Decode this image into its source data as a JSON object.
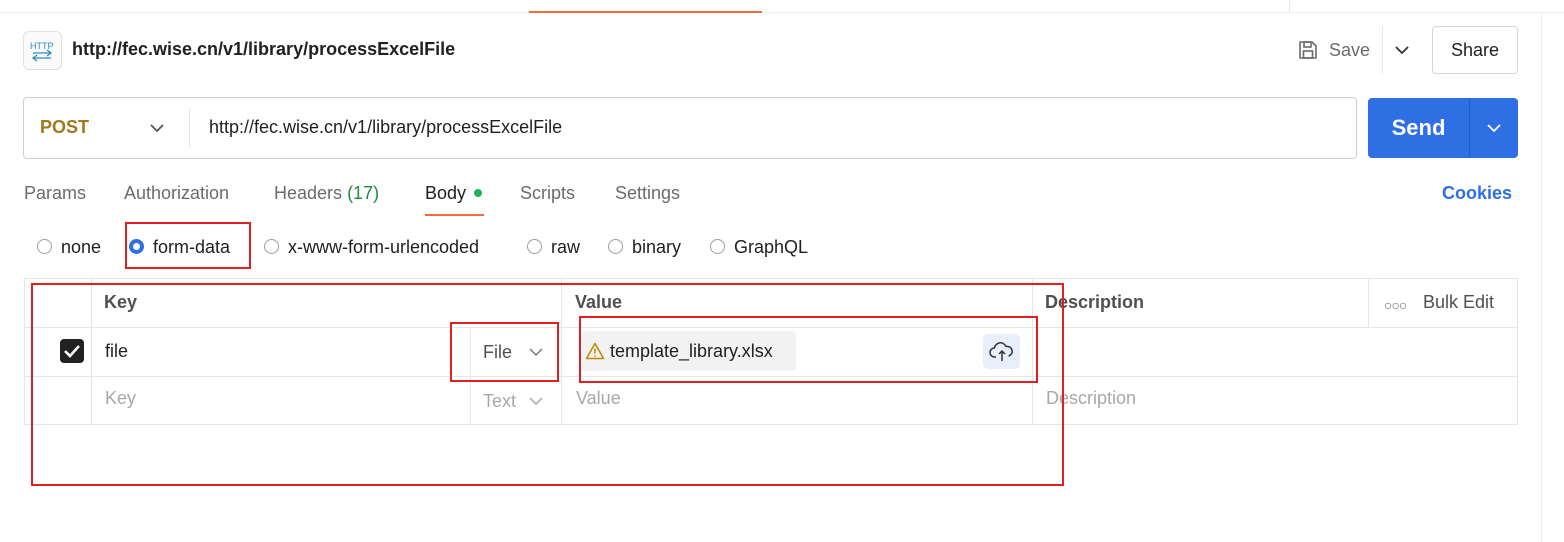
{
  "request": {
    "title": "http://fec.wise.cn/v1/library/processExcelFile",
    "method": "POST",
    "url": "http://fec.wise.cn/v1/library/processExcelFile"
  },
  "toolbar": {
    "save_label": "Save",
    "share_label": "Share",
    "send_label": "Send"
  },
  "tabs": [
    {
      "label": "Params"
    },
    {
      "label": "Authorization"
    },
    {
      "label": "Headers",
      "count": "(17)"
    },
    {
      "label": "Body",
      "active": true
    },
    {
      "label": "Scripts"
    },
    {
      "label": "Settings"
    }
  ],
  "cookies_label": "Cookies",
  "body_types": [
    {
      "label": "none",
      "selected": false
    },
    {
      "label": "form-data",
      "selected": true
    },
    {
      "label": "x-www-form-urlencoded",
      "selected": false
    },
    {
      "label": "raw",
      "selected": false
    },
    {
      "label": "binary",
      "selected": false
    },
    {
      "label": "GraphQL",
      "selected": false
    }
  ],
  "table": {
    "headers": {
      "key": "Key",
      "value": "Value",
      "description": "Description",
      "bulk_edit": "Bulk Edit"
    },
    "rows": [
      {
        "checked": true,
        "key": "file",
        "type": "File",
        "value": "template_library.xlsx",
        "description": ""
      }
    ],
    "new_row": {
      "key_placeholder": "Key",
      "type": "Text",
      "value_placeholder": "Value",
      "description_placeholder": "Description"
    }
  },
  "colors": {
    "accent": "#2f6fe4",
    "method": "#a0791a",
    "active_tab": "#f26b3a",
    "highlight": "#e02020"
  }
}
